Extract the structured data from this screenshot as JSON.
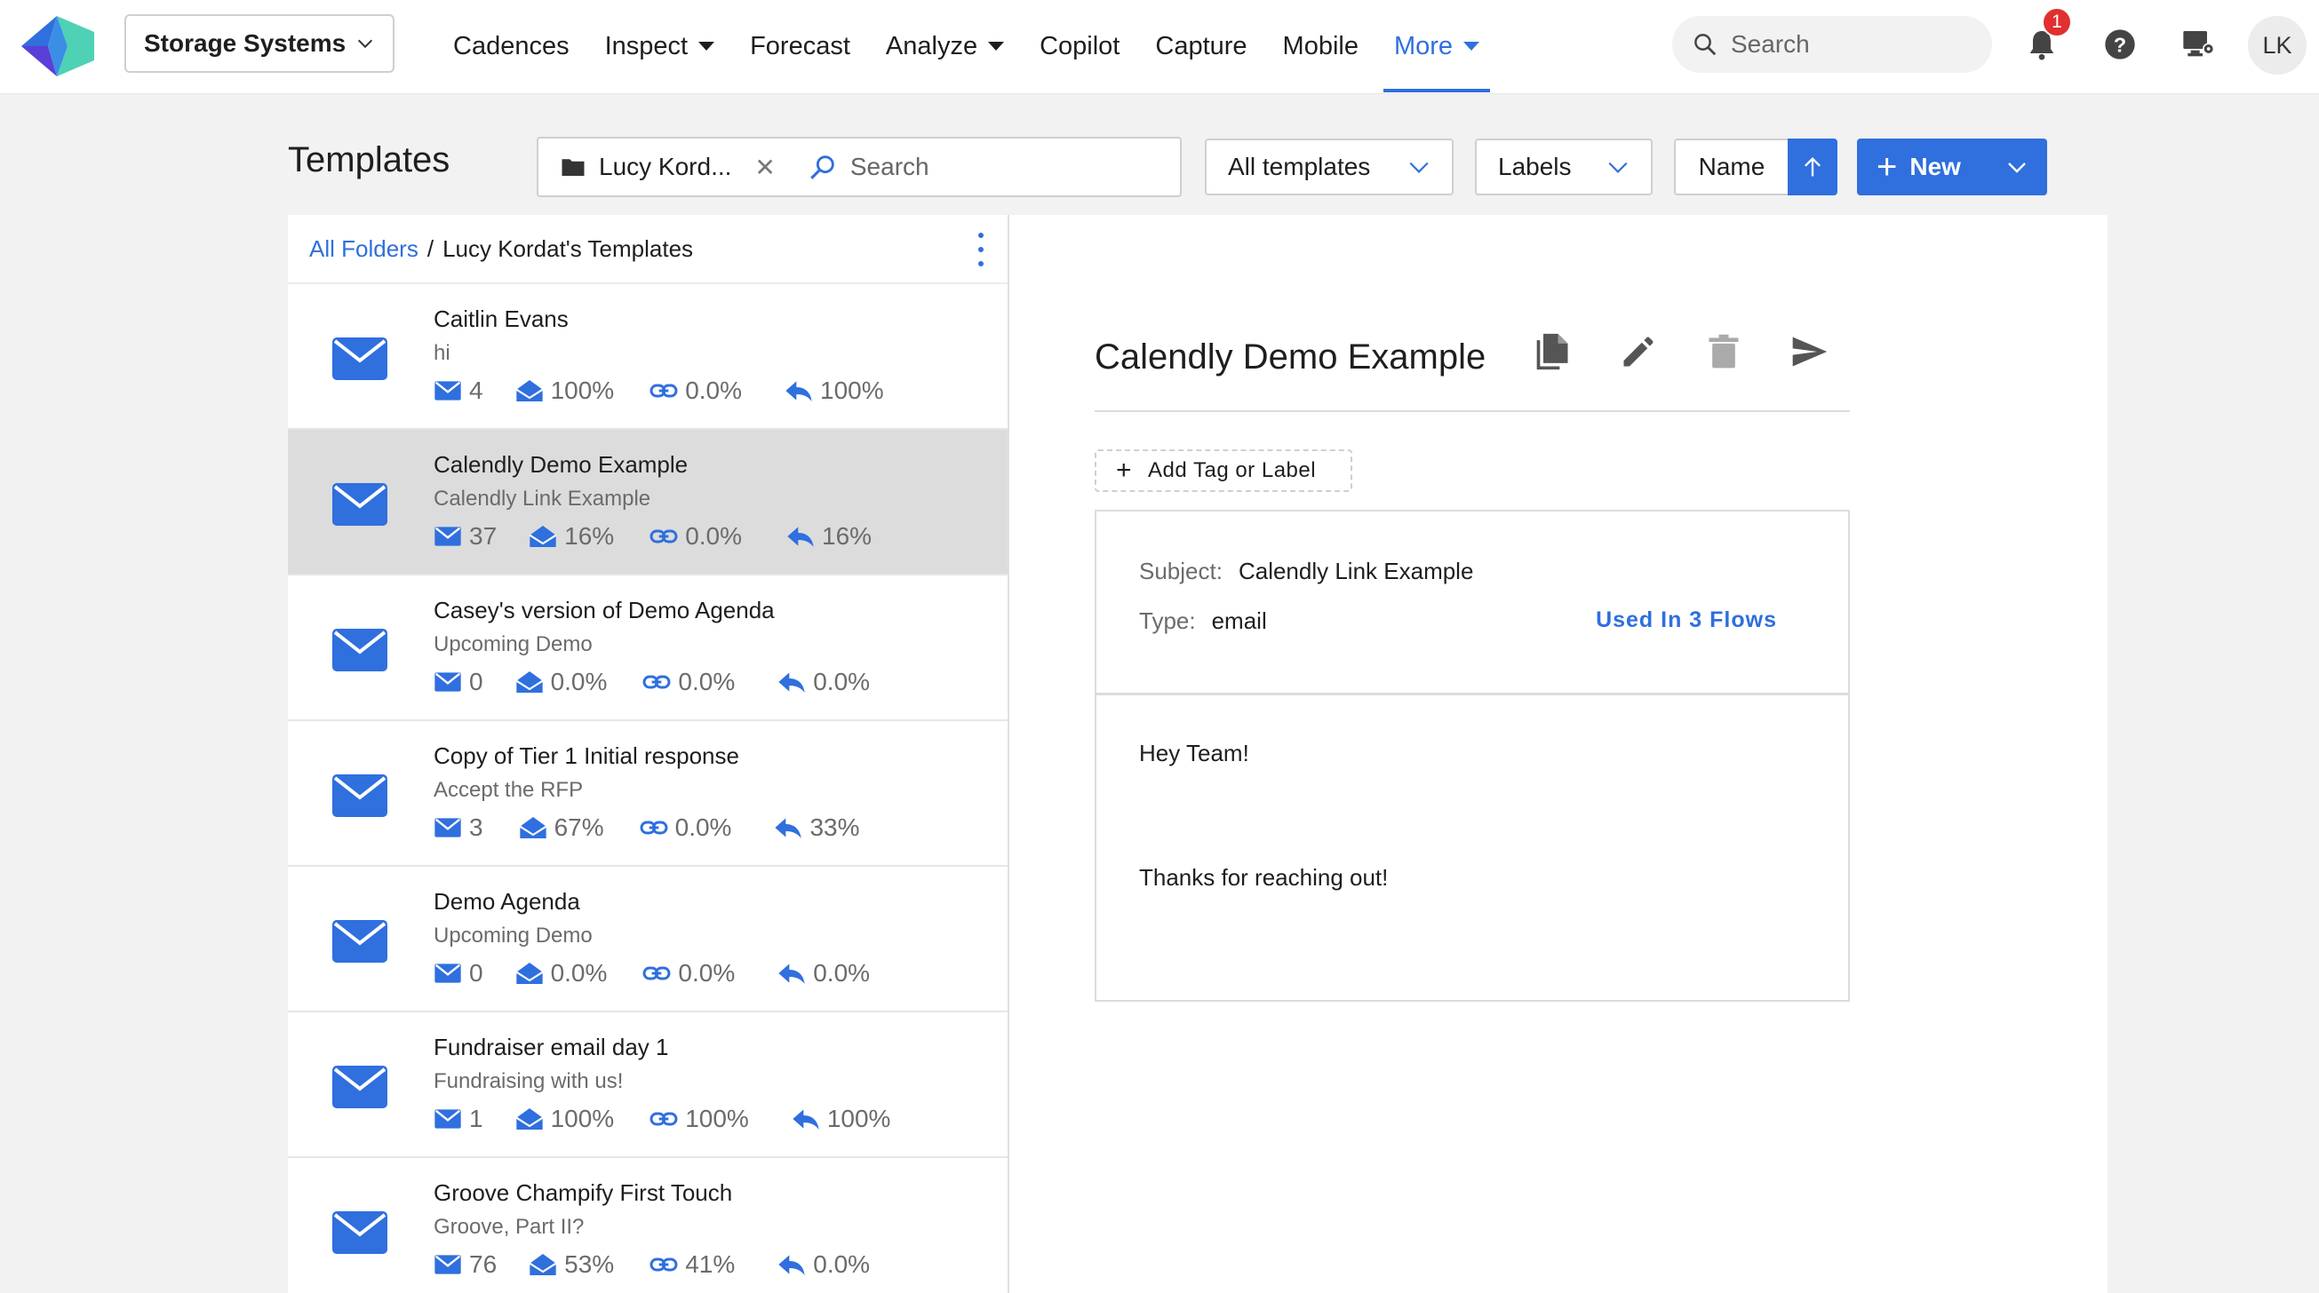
{
  "app": {
    "org_name": "Storage Systems",
    "nav": [
      {
        "label": "Cadences",
        "has_menu": false
      },
      {
        "label": "Inspect",
        "has_menu": true
      },
      {
        "label": "Forecast",
        "has_menu": false
      },
      {
        "label": "Analyze",
        "has_menu": true
      },
      {
        "label": "Copilot",
        "has_menu": false
      },
      {
        "label": "Capture",
        "has_menu": false
      },
      {
        "label": "Mobile",
        "has_menu": false
      },
      {
        "label": "More",
        "has_menu": true,
        "active": true
      }
    ],
    "search_placeholder": "Search",
    "notification_count": "1",
    "user_initials": "LK",
    "accent_color": "#2f6fde"
  },
  "toolbar": {
    "page_title": "Templates",
    "folder_chip": "Lucy Kord...",
    "search_placeholder": "Search",
    "templates_filter": "All templates",
    "labels_filter": "Labels",
    "sort_field": "Name",
    "sort_direction": "ascending",
    "new_label": "New"
  },
  "list": {
    "breadcrumb_root": "All Folders",
    "breadcrumb_separator": "/",
    "breadcrumb_current": "Lucy Kordat's Templates",
    "templates": [
      {
        "name": "Caitlin Evans",
        "subject": "hi",
        "sent": "4",
        "opened": "100%",
        "clicked": "0.0%",
        "replied": "100%",
        "selected": false
      },
      {
        "name": "Calendly Demo Example",
        "subject": "Calendly Link Example",
        "sent": "37",
        "opened": "16%",
        "clicked": "0.0%",
        "replied": "16%",
        "selected": true
      },
      {
        "name": "Casey's version of Demo Agenda",
        "subject": "Upcoming Demo",
        "sent": "0",
        "opened": "0.0%",
        "clicked": "0.0%",
        "replied": "0.0%",
        "selected": false
      },
      {
        "name": "Copy of Tier 1 Initial response",
        "subject": "Accept the RFP",
        "sent": "3",
        "opened": "67%",
        "clicked": "0.0%",
        "replied": "33%",
        "selected": false
      },
      {
        "name": "Demo Agenda",
        "subject": "Upcoming Demo",
        "sent": "0",
        "opened": "0.0%",
        "clicked": "0.0%",
        "replied": "0.0%",
        "selected": false
      },
      {
        "name": "Fundraiser email day 1",
        "subject": "Fundraising with us!",
        "sent": "1",
        "opened": "100%",
        "clicked": "100%",
        "replied": "100%",
        "selected": false
      },
      {
        "name": "Groove Champify First Touch",
        "subject": "Groove, Part II?",
        "sent": "76",
        "opened": "53%",
        "clicked": "41%",
        "replied": "0.0%",
        "selected": false
      }
    ]
  },
  "detail": {
    "title": "Calendly Demo Example",
    "add_tag_label": "Add Tag or Label",
    "subject_key": "Subject:",
    "subject_value": "Calendly Link Example",
    "type_key": "Type:",
    "type_value": "email",
    "used_in": "Used In 3 Flows",
    "body_lines": [
      "Hey Team!",
      "Thanks for reaching out!"
    ]
  }
}
